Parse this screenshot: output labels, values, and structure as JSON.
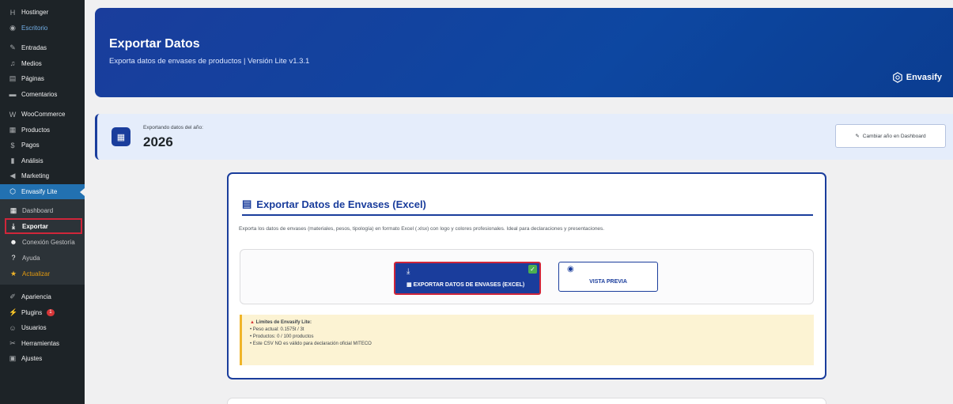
{
  "sidebar": {
    "items": [
      {
        "icon": "hostinger-icon",
        "label": "Hostinger"
      },
      {
        "icon": "dashboard-icon",
        "label": "Escritorio"
      },
      {
        "icon": "pin-icon",
        "label": "Entradas"
      },
      {
        "icon": "media-icon",
        "label": "Medios"
      },
      {
        "icon": "pages-icon",
        "label": "Páginas"
      },
      {
        "icon": "comments-icon",
        "label": "Comentarios"
      },
      {
        "icon": "woocommerce-icon",
        "label": "WooCommerce"
      },
      {
        "icon": "products-icon",
        "label": "Productos"
      },
      {
        "icon": "payments-icon",
        "label": "Pagos"
      },
      {
        "icon": "analytics-icon",
        "label": "Análisis"
      },
      {
        "icon": "marketing-icon",
        "label": "Marketing"
      },
      {
        "icon": "envasify-icon",
        "label": "Envasify Lite"
      }
    ],
    "submenu": [
      {
        "icon": "dashboard-grid-icon",
        "label": "Dashboard"
      },
      {
        "icon": "download-icon",
        "label": "Exportar"
      },
      {
        "icon": "user-plus-icon",
        "label": "Conexión Gestoría"
      },
      {
        "icon": "help-icon",
        "label": "Ayuda"
      },
      {
        "icon": "star-icon",
        "label": "Actualizar"
      }
    ],
    "bottom": [
      {
        "icon": "appearance-icon",
        "label": "Apariencia"
      },
      {
        "icon": "plugins-icon",
        "label": "Plugins",
        "badge": "1"
      },
      {
        "icon": "users-icon",
        "label": "Usuarios"
      },
      {
        "icon": "tools-icon",
        "label": "Herramientas"
      },
      {
        "icon": "settings-icon",
        "label": "Ajustes"
      }
    ]
  },
  "header": {
    "title": "Exportar Datos",
    "subtitle": "Exporta datos de envases de productos | Versión Lite v1.3.1",
    "brand": "Envasify"
  },
  "year": {
    "label": "Exportando datos del año:",
    "value": "2026",
    "change_button": "Cambiar año en Dashboard"
  },
  "export_card": {
    "title": "Exportar Datos de Envases (Excel)",
    "description": "Exporta los datos de envases (materiales, pesos, tipología) en formato Excel (.xlsx) con logo y colores profesionales. Ideal para declaraciones y presentaciones.",
    "export_button": "EXPORTAR DATOS DE ENVASES (EXCEL)",
    "preview_button": "VISTA PREVIA",
    "limits": {
      "title": "Límites de Envasify Lite:",
      "lines": [
        "• Peso actual: 0.1575t / 3t",
        "• Productos: 0 / 100 productos",
        "• Este CSV NO es válido para declaración oficial MITECO"
      ]
    }
  },
  "colors": {
    "primary": "#1a3d9c",
    "highlight": "#d0263a",
    "warning_bg": "#fcf3d3",
    "sidebar": "#1d2327"
  }
}
